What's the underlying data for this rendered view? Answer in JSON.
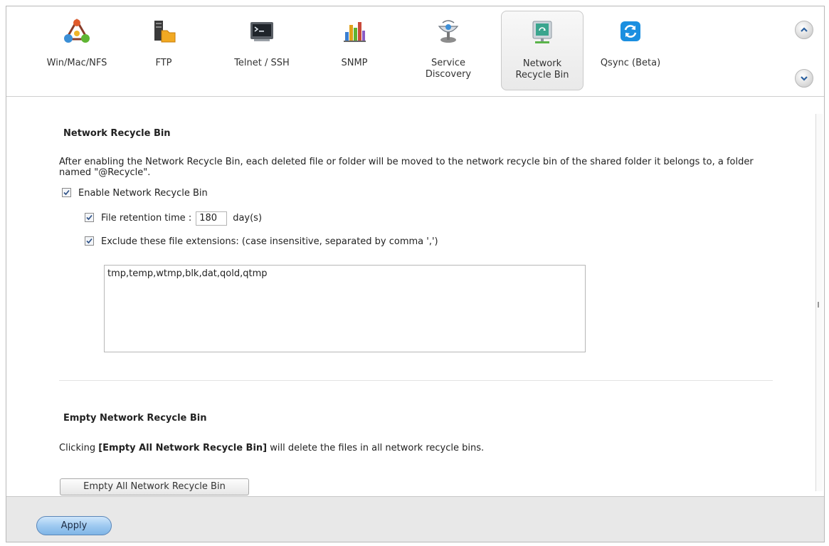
{
  "tabs": [
    {
      "label": "Win/Mac/NFS",
      "icon": "win-mac-nfs-icon"
    },
    {
      "label": "FTP",
      "icon": "ftp-icon"
    },
    {
      "label": "Telnet / SSH",
      "icon": "terminal-icon"
    },
    {
      "label": "SNMP",
      "icon": "snmp-chart-icon"
    },
    {
      "label": "Service\nDiscovery",
      "icon": "service-discovery-icon"
    },
    {
      "label": "Network\nRecycle Bin",
      "icon": "recycle-bin-icon",
      "active": true
    },
    {
      "label": "Qsync (Beta)",
      "icon": "qsync-icon"
    }
  ],
  "recycle": {
    "title": "Network Recycle Bin",
    "description": "After enabling the Network Recycle Bin, each deleted file or folder will be moved to the network recycle bin of the shared folder it belongs to, a folder named \"@Recycle\".",
    "enable_label": "Enable Network Recycle Bin",
    "enable_checked": true,
    "retention_label": "File retention time :",
    "retention_checked": true,
    "retention_value": "180",
    "retention_unit": "day(s)",
    "exclude_label": "Exclude these file extensions: (case insensitive, separated by comma ',')",
    "exclude_checked": true,
    "exclude_value": "tmp,temp,wtmp,blk,dat,qold,qtmp"
  },
  "empty": {
    "title": "Empty Network Recycle Bin",
    "desc_prefix": "Clicking ",
    "desc_bold": "[Empty All Network Recycle Bin]",
    "desc_suffix": " will delete the files in all network recycle bins.",
    "button_label": "Empty All Network Recycle Bin"
  },
  "footer": {
    "apply_label": "Apply"
  },
  "colors": {
    "apply_blue": "#9fcaf1",
    "qsync_blue": "#1b8fe0",
    "recycle_teal": "#3aa58e"
  }
}
